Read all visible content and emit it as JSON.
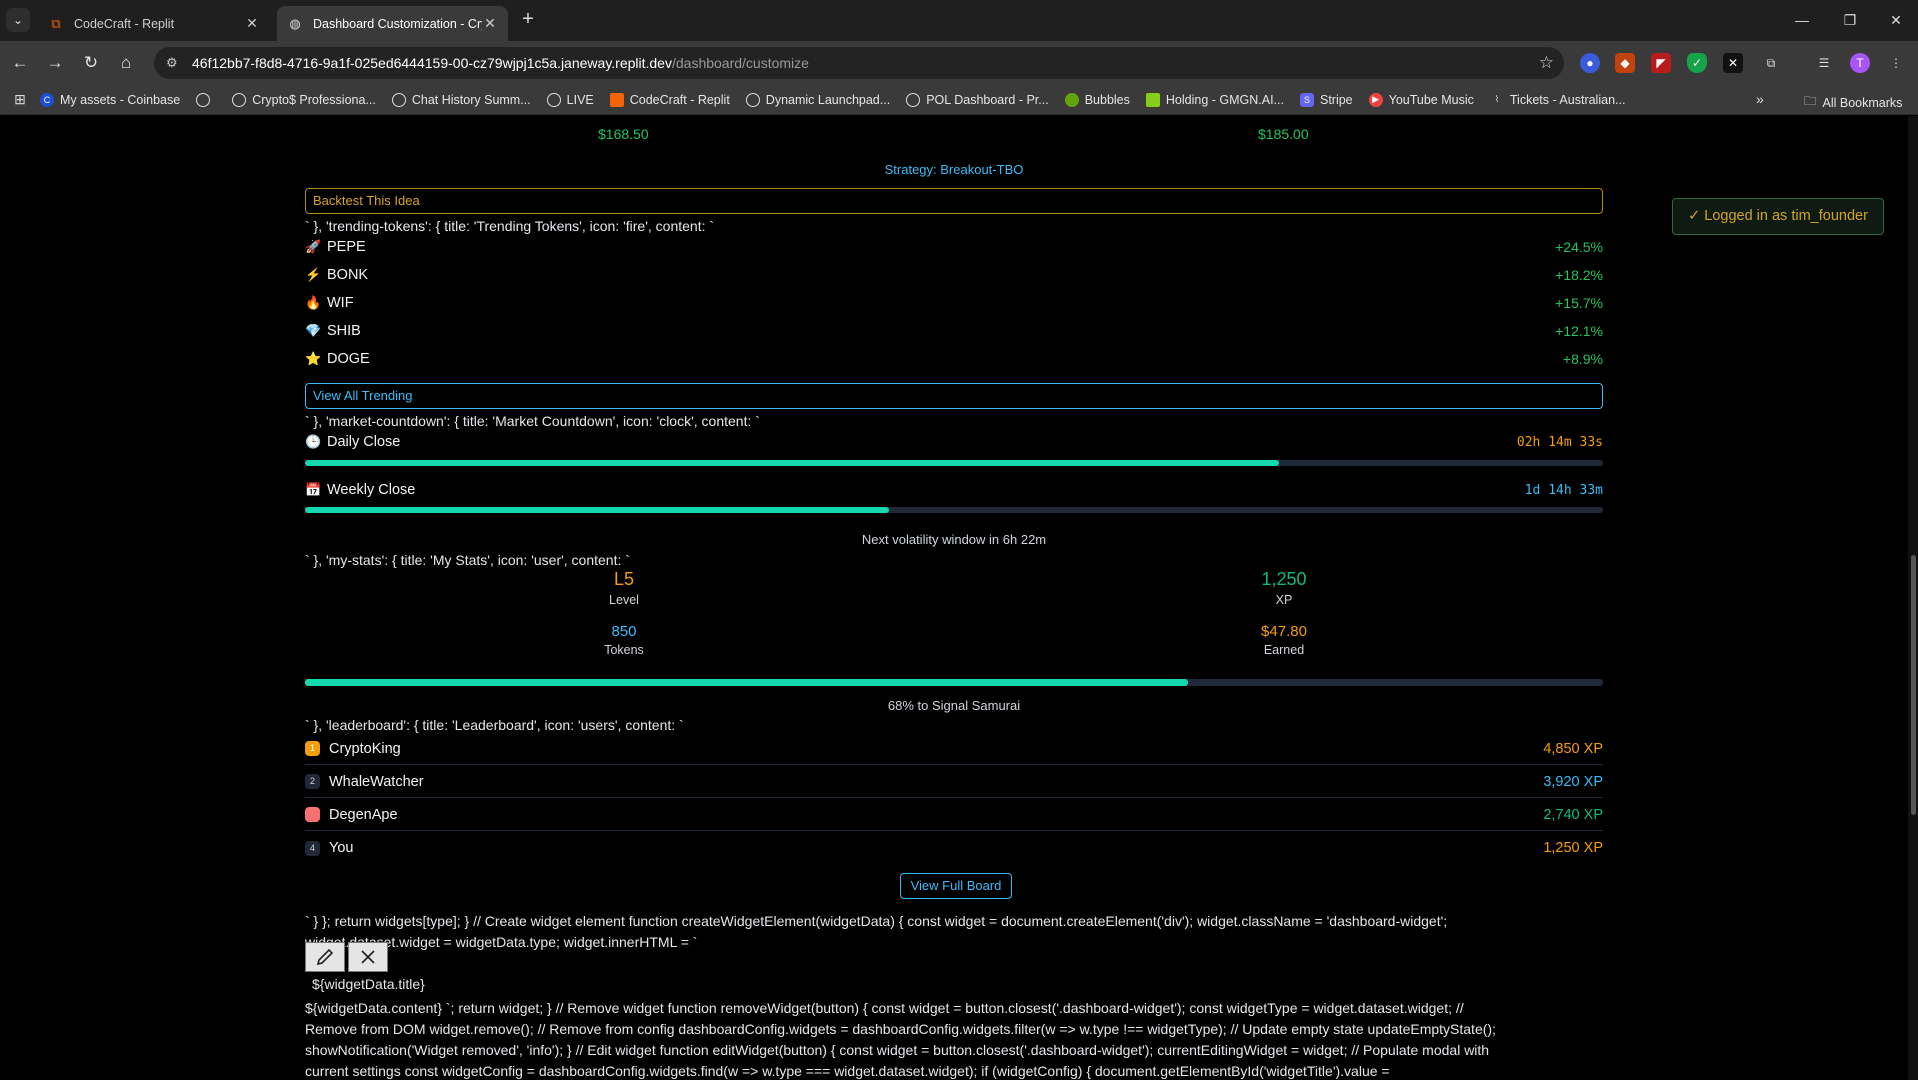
{
  "browser": {
    "tabs": [
      {
        "title": "CodeCraft - Replit",
        "active": false
      },
      {
        "title": "Dashboard Customization - Cry",
        "active": true
      }
    ],
    "url_host": "46f12bb7-f8d8-4716-9a1f-025ed6444159-00-cz79wjpj1c5a.janeway.replit.dev",
    "url_path": "/dashboard/customize",
    "bookmarks": [
      "My assets - Coinbase",
      "",
      "Crypto$ Professiona...",
      "Chat History Summ...",
      "LIVE",
      "CodeCraft - Replit",
      "Dynamic Launchpad...",
      "POL Dashboard - Pr...",
      "Bubbles",
      "Holding - GMGN.AI...",
      "Stripe",
      "YouTube Music",
      "Tickets - Australian..."
    ],
    "all_bookmarks": "All Bookmarks",
    "profile_initial": "T"
  },
  "header": {
    "price_left": "$168.50",
    "price_right": "$185.00",
    "strategy": "Strategy: Breakout-TBO",
    "backtest_button": "Backtest This Idea"
  },
  "login_badge": "✓ Logged in as tim_founder",
  "trending": {
    "code_line": "` }, 'trending-tokens': { title: 'Trending Tokens', icon: 'fire', content: `",
    "items": [
      {
        "emoji": "🚀",
        "name": "PEPE",
        "change": "+24.5%"
      },
      {
        "emoji": "⚡",
        "name": "BONK",
        "change": "+18.2%"
      },
      {
        "emoji": "🔥",
        "name": "WIF",
        "change": "+15.7%"
      },
      {
        "emoji": "💎",
        "name": "SHIB",
        "change": "+12.1%"
      },
      {
        "emoji": "⭐",
        "name": "DOGE",
        "change": "+8.9%"
      }
    ],
    "view_all": "View All Trending"
  },
  "countdown": {
    "code_line": "` }, 'market-countdown': { title: 'Market Countdown', icon: 'clock', content: `",
    "daily_label": "Daily Close",
    "daily_time": "02h 14m 33s",
    "daily_progress": 0.75,
    "weekly_label": "Weekly Close",
    "weekly_time": "1d 14h 33m",
    "weekly_progress": 0.45,
    "volatility": "Next volatility window in 6h 22m"
  },
  "stats": {
    "code_line": "` }, 'my-stats': { title: 'My Stats', icon: 'user', content: `",
    "level": "L5",
    "level_label": "Level",
    "xp": "1,250",
    "xp_label": "XP",
    "tokens": "850",
    "tokens_label": "Tokens",
    "earned": "$47.80",
    "earned_label": "Earned",
    "progress": 0.68,
    "progress_text": "68% to Signal Samurai"
  },
  "leaderboard": {
    "code_line": "` }, 'leaderboard': { title: 'Leaderboard', icon: 'users', content: `",
    "rows": [
      {
        "rank": "1",
        "name": "CryptoKing",
        "xp": "4,850 XP"
      },
      {
        "rank": "2",
        "name": "WhaleWatcher",
        "xp": "3,920 XP"
      },
      {
        "rank": "",
        "name": "DegenApe",
        "xp": "2,740 XP"
      },
      {
        "rank": "4",
        "name": "You",
        "xp": "1,250 XP"
      }
    ],
    "view_full": "View Full Board"
  },
  "code": {
    "line1": "` } }; return widgets[type]; } // Create widget element function createWidgetElement(widgetData) { const widget = document.createElement('div'); widget.className = 'dashboard-widget';",
    "line2": "widget.dataset.widget = widgetData.type; widget.innerHTML = `",
    "title_template": "${widgetData.title}",
    "line3": "${widgetData.content} `; return widget; } // Remove widget function removeWidget(button) { const widget = button.closest('.dashboard-widget'); const widgetType = widget.dataset.widget; //",
    "line4": "Remove from DOM widget.remove(); // Remove from config dashboardConfig.widgets = dashboardConfig.widgets.filter(w => w.type !== widgetType); // Update empty state updateEmptyState();",
    "line5": "showNotification('Widget removed', 'info'); } // Edit widget function editWidget(button) { const widget = button.closest('.dashboard-widget'); currentEditingWidget = widget; // Populate modal with",
    "line6": "current settings const widgetConfig = dashboardConfig.widgets.find(w => w.type === widget.dataset.widget); if (widgetConfig) { document.getElementById('widgetTitle').value ="
  },
  "colors": {
    "accent_green": "#10b981",
    "accent_orange": "#f59e0b",
    "accent_blue": "#38bdf8",
    "progress_fill": "#14d9b0"
  }
}
